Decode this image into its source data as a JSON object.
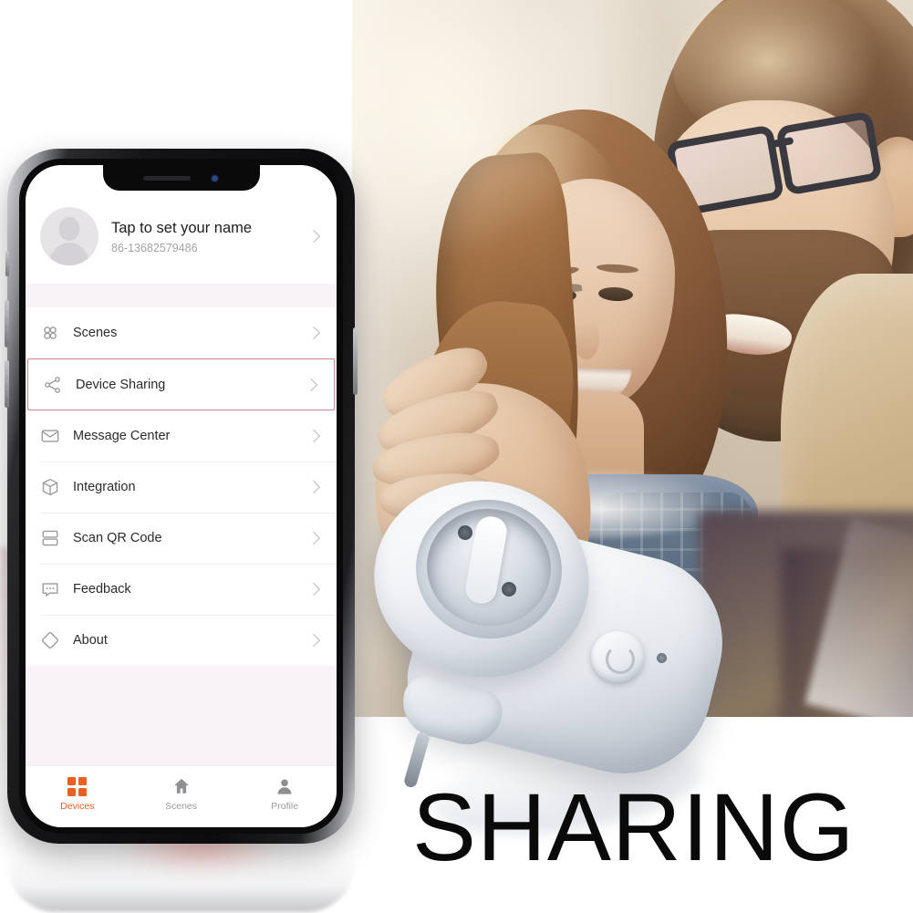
{
  "scene": {
    "marketing_headline": "SHARING",
    "product_name": "smart-plug",
    "background_photo": "couple-looking-at-phone"
  },
  "phone": {
    "notch": {
      "speaker": "speaker-slot",
      "camera": "front-camera"
    },
    "buttons": [
      "silent-switch",
      "volume-up",
      "volume-down",
      "power"
    ]
  },
  "app": {
    "profile": {
      "avatar": "default-avatar",
      "name": "Tap to set your name",
      "phone": "86-13682579486",
      "chevron": "chevron-right-icon"
    },
    "menu": [
      {
        "label": "Scenes",
        "icon": "scenes-icon",
        "selected": false
      },
      {
        "label": "Device Sharing",
        "icon": "share-icon",
        "selected": true
      },
      {
        "label": "Message Center",
        "icon": "envelope-icon",
        "selected": false
      },
      {
        "label": "Integration",
        "icon": "cube-icon",
        "selected": false
      },
      {
        "label": "Scan QR Code",
        "icon": "scan-icon",
        "selected": false
      },
      {
        "label": "Feedback",
        "icon": "speech-bubble-icon",
        "selected": false
      },
      {
        "label": "About",
        "icon": "diamond-icon",
        "selected": false
      }
    ],
    "tabs": [
      {
        "label": "Devices",
        "icon": "grid-icon",
        "active": true
      },
      {
        "label": "Scenes",
        "icon": "home-icon",
        "active": false
      },
      {
        "label": "Profile",
        "icon": "person-icon",
        "active": false
      }
    ]
  },
  "colors": {
    "accent": "#e8601f",
    "highlight_border": "#c98585",
    "band": "#f9f2f6",
    "label": "#2b2b2e",
    "muted": "#9b9b9f",
    "headline": "#0a0a0a"
  }
}
